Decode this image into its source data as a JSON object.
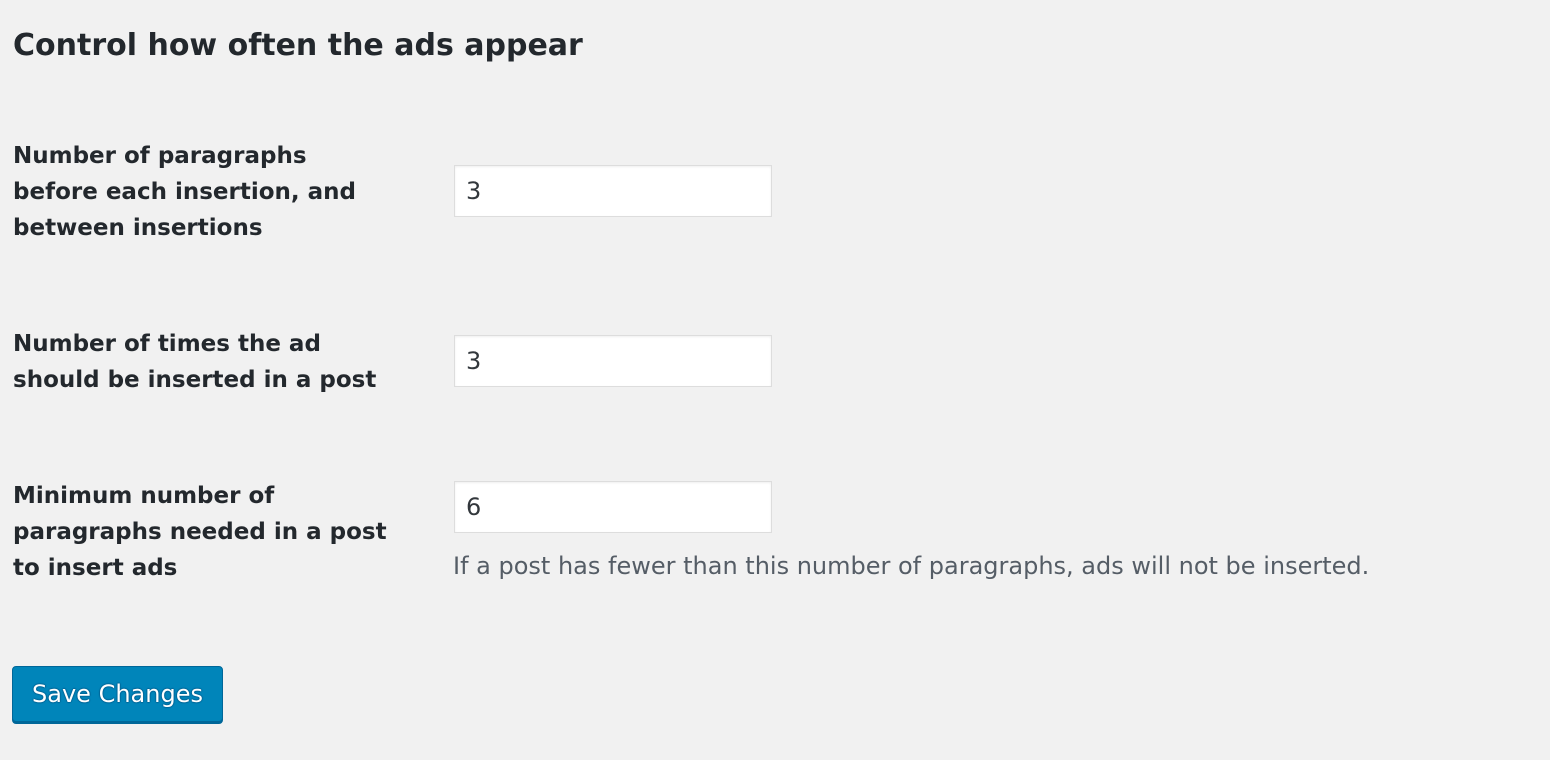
{
  "section": {
    "title": "Control how often the ads appear"
  },
  "settings": [
    {
      "label_lines": [
        "Number of paragraphs",
        "before each insertion, and",
        "between insertions"
      ],
      "value": "3"
    },
    {
      "label_lines": [
        "Number of times the ad",
        "should be inserted in a post"
      ],
      "value": "3"
    },
    {
      "label_lines": [
        "Minimum number of",
        "paragraphs needed in a post",
        "to insert ads"
      ],
      "value": "6",
      "description": "If a post has fewer than this number of paragraphs, ads will not be inserted."
    }
  ],
  "actions": {
    "save_label": "Save Changes"
  },
  "colors": {
    "background": "#f1f1f1",
    "text": "#23282d",
    "button_primary": "#0085ba",
    "button_border": "#006799"
  }
}
